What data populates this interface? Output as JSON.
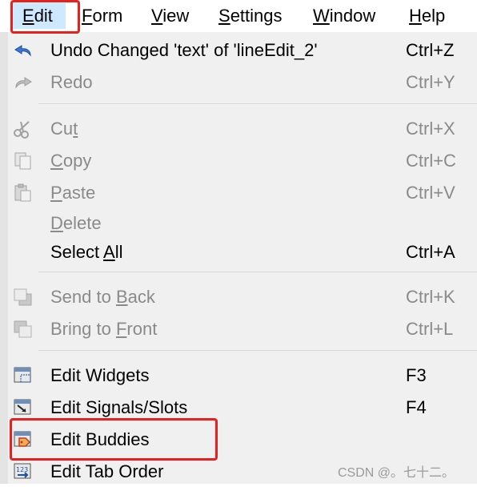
{
  "menubar": {
    "items": [
      {
        "label": "Edit",
        "access": "E",
        "rest": "dit"
      },
      {
        "label": "Form",
        "access": "F",
        "rest": "orm"
      },
      {
        "label": "View",
        "access": "V",
        "rest": "iew"
      },
      {
        "label": "Settings",
        "access": "S",
        "rest": "ettings"
      },
      {
        "label": "Window",
        "access": "W",
        "rest": "indow"
      },
      {
        "label": "Help",
        "access": "H",
        "rest": "elp"
      }
    ]
  },
  "menu": {
    "undo": {
      "label": "Undo Changed 'text' of 'lineEdit_2'",
      "shortcut": "Ctrl+Z"
    },
    "redo": {
      "label": "Redo",
      "shortcut": "Ctrl+Y"
    },
    "cut": {
      "pre": "Cu",
      "access": "t",
      "post": "",
      "shortcut": "Ctrl+X"
    },
    "copy": {
      "pre": "",
      "access": "C",
      "post": "opy",
      "shortcut": "Ctrl+C"
    },
    "paste": {
      "pre": "",
      "access": "P",
      "post": "aste",
      "shortcut": "Ctrl+V"
    },
    "delete": {
      "pre": "",
      "access": "D",
      "post": "elete"
    },
    "select_all": {
      "pre": "Select ",
      "access": "A",
      "post": "ll",
      "shortcut": "Ctrl+A"
    },
    "send_to_back": {
      "pre": "Send to ",
      "access": "B",
      "post": "ack",
      "shortcut": "Ctrl+K"
    },
    "bring_to_front": {
      "pre": "Bring to ",
      "access": "F",
      "post": "ront",
      "shortcut": "Ctrl+L"
    },
    "edit_widgets": {
      "label": "Edit Widgets",
      "shortcut": "F3"
    },
    "edit_signals_slots": {
      "label": "Edit Signals/Slots",
      "shortcut": "F4"
    },
    "edit_buddies": {
      "label": "Edit Buddies"
    },
    "edit_tab_order": {
      "label": "Edit Tab Order"
    }
  },
  "watermark": "CSDN @。七十二。",
  "colors": {
    "highlight_box": "#e8211f",
    "active_menu_bg": "#cde8ff",
    "menu_bg": "#f0f0f0",
    "disabled_text": "#8a8a8a"
  }
}
